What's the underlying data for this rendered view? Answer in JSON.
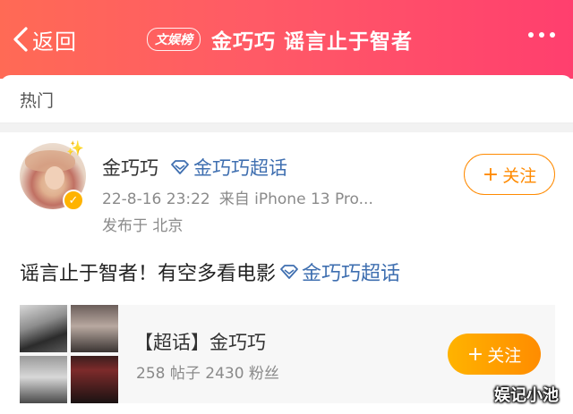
{
  "header": {
    "back_label": "返回",
    "tag": "文娱榜",
    "title": "金巧巧 谣言止于智者",
    "more_icon": "more-dots-icon"
  },
  "tabs": {
    "hot_label": "热门"
  },
  "post": {
    "username": "金巧巧",
    "badge_label": "金巧巧超话",
    "time": "22-8-16 23:22",
    "source": "来自 iPhone 13 Pro...",
    "location": "发布于 北京",
    "follow_plus": "+",
    "follow_label": "关注",
    "content": "谣言止于智者！有空多看电影",
    "content_link": "金巧巧超话"
  },
  "card": {
    "title": "【超话】金巧巧",
    "stats": "258 帖子  2430 粉丝",
    "follow_plus": "+",
    "follow_label": "关注"
  },
  "watermark": "娱记小池",
  "colors": {
    "header_start": "#ff6a55",
    "header_end": "#ff3f6e",
    "link": "#3f6fb0",
    "follow_accent": "#ff8a00",
    "verified": "#ffb300"
  }
}
